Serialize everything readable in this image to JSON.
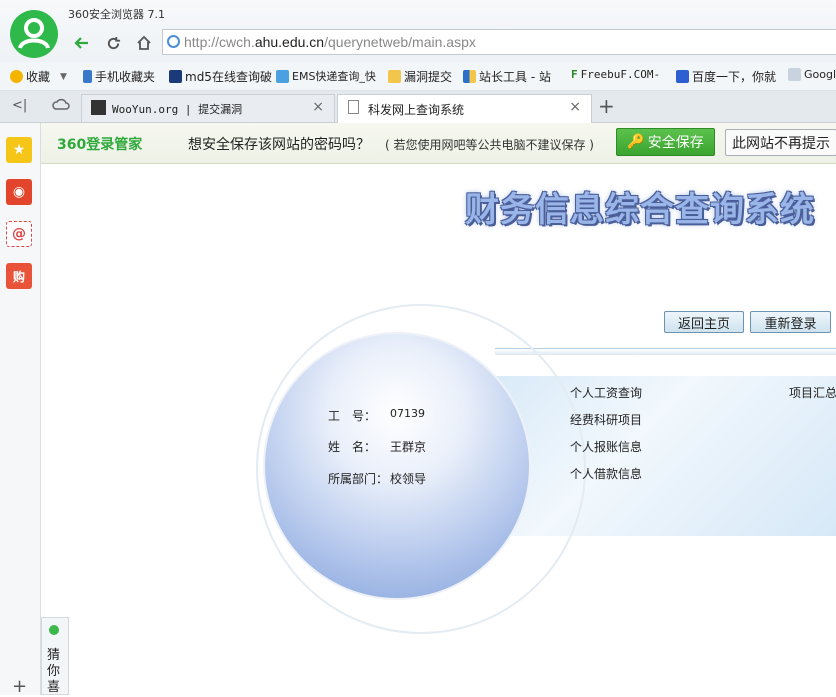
{
  "browser": {
    "title": "360安全浏览器 7.1",
    "url_prefix": "http://cwch.",
    "url_domain": "ahu.edu.cn",
    "url_suffix": "/querynetweb/main.aspx"
  },
  "bookmarks": [
    {
      "label": "收藏"
    },
    {
      "label": "手机收藏夹"
    },
    {
      "label": "md5在线查询破"
    },
    {
      "label": "EMS快递查询_快"
    },
    {
      "label": "漏洞提交"
    },
    {
      "label": "站长工具 - 站"
    },
    {
      "label": "FreebuF.COM-"
    },
    {
      "label": "百度一下，你就"
    },
    {
      "label": "Googl"
    }
  ],
  "tabs": [
    {
      "label": "WooYun.org | 提交漏洞"
    },
    {
      "label": "科发网上查询系统"
    }
  ],
  "pwbar": {
    "logo": "360登录管家",
    "text": "想安全保存该网站的密码吗？",
    "note": "( 若您使用网吧等公共电脑不建议保存 )",
    "save": "安全保存",
    "never": "此网站不再提示"
  },
  "page": {
    "title": "财务信息综合查询系统",
    "home_btn": "返回主页",
    "relogin_btn": "重新登录",
    "info": {
      "id_label": "工　号：",
      "id_value": "07139",
      "name_label": "姓　名：",
      "name_value": "王群京",
      "dept_label": "所属部门：",
      "dept_value": "校领导"
    },
    "links": [
      "个人工资查询",
      "经费科研项目",
      "个人报账信息",
      "个人借款信息"
    ],
    "link_right": "项目汇总"
  },
  "guess": "猜你喜",
  "colors": {
    "green": "#2fb94a",
    "accent": "#4a8fd8"
  }
}
